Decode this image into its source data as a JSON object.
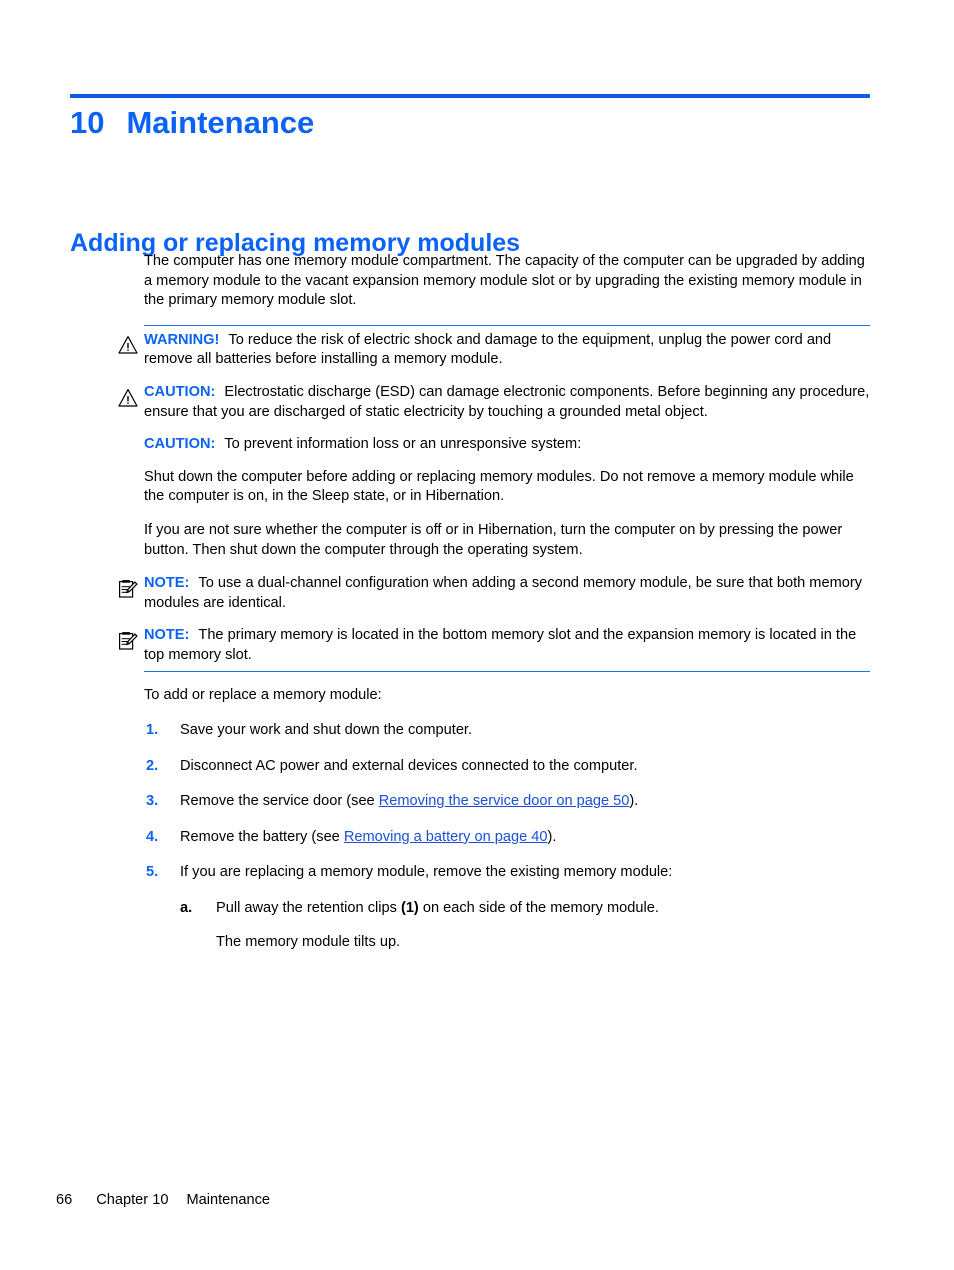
{
  "colors": {
    "heading_blue": "#0b63f6",
    "rule_blue": "#0b5fe4",
    "admon_border": "#1b6ff0",
    "link_blue": "#1b4fd8",
    "text_black": "#000000"
  },
  "chapter": {
    "number": "10",
    "title": "Maintenance"
  },
  "section": {
    "title": "Adding or replacing memory modules"
  },
  "intro": {
    "paragraph": "The computer has one memory module compartment. The capacity of the computer can be upgraded by adding a memory module to the vacant expansion memory module slot or by upgrading the existing memory module in the primary memory module slot."
  },
  "admonitions": [
    {
      "id": "warning",
      "icon": "warning-triangle-icon",
      "label": "WARNING!",
      "text": "To reduce the risk of electric shock and damage to the equipment, unplug the power cord and remove all batteries before installing a memory module."
    },
    {
      "id": "caution-esd",
      "icon": "warning-triangle-icon",
      "label": "CAUTION:",
      "text": "Electrostatic discharge (ESD) can damage electronic components. Before beginning any procedure, ensure that you are discharged of static electricity by touching a grounded metal object."
    },
    {
      "id": "caution-dataloss",
      "icon": "none",
      "label": "CAUTION:",
      "text": "To prevent information loss or an unresponsive system:"
    },
    {
      "id": "note-dual-channel",
      "icon": "note-clipboard-icon",
      "label": "NOTE:",
      "text": "To use a dual-channel configuration when adding a second memory module, be sure that both memory modules are identical."
    },
    {
      "id": "note-memory-slot",
      "icon": "note-clipboard-icon",
      "label": "NOTE:",
      "text": "The primary memory is located in the bottom memory slot and the expansion memory is located in the top memory slot."
    }
  ],
  "caution_body": {
    "paragraph_1": "Shut down the computer before adding or replacing memory modules. Do not remove a memory module while the computer is on, in the Sleep state, or in Hibernation.",
    "paragraph_2": "If you are not sure whether the computer is off or in Hibernation, turn the computer on by pressing the power button. Then shut down the computer through the operating system."
  },
  "procedure": {
    "lead_in": "To add or replace a memory module:",
    "steps": [
      {
        "marker": "1.",
        "text": "Save your work and shut down the computer."
      },
      {
        "marker": "2.",
        "text": "Disconnect AC power and external devices connected to the computer."
      },
      {
        "marker": "3.",
        "text_before": "Remove the service door (see ",
        "link": "Removing the service door on page 50",
        "text_after": ")."
      },
      {
        "marker": "4.",
        "text_before": "Remove the battery (see ",
        "link": "Removing a battery on page 40",
        "text_after": ")."
      },
      {
        "marker": "5.",
        "text": "If you are replacing a memory module, remove the existing memory module:",
        "substeps": [
          {
            "marker": "a.",
            "text_before": "Pull away the retention clips ",
            "bold": "(1)",
            "text_after": " on each side of the memory module.",
            "follow_up": "The memory module tilts up."
          }
        ]
      }
    ]
  },
  "footer": {
    "page_number": "66",
    "chapter_label": "Chapter 10",
    "chapter_title": "Maintenance"
  }
}
